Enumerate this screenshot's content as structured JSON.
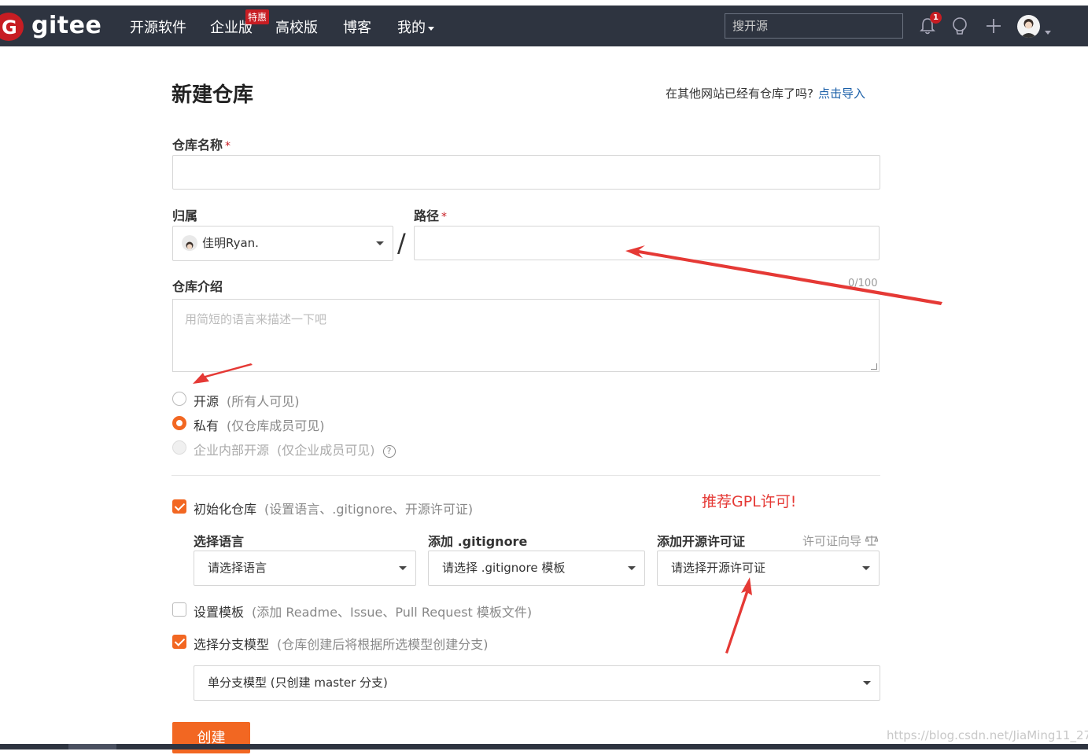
{
  "nav": {
    "logo": "gitee",
    "items": [
      "开源软件",
      "企业版",
      "高校版",
      "博客",
      "我的"
    ],
    "hot_badge": "特惠",
    "search_placeholder": "搜开源",
    "notification_count": "1"
  },
  "form": {
    "title": "新建仓库",
    "import_text": "在其他网站已经有仓库了吗?",
    "import_link": "点击导入",
    "repo_name_label": "仓库名称",
    "required_mark": "*",
    "owner_label": "归属",
    "owner_value": "佳明Ryan.",
    "path_label": "路径",
    "desc_label": "仓库介绍",
    "desc_counter": "0/100",
    "desc_placeholder": "用简短的语言来描述一下吧",
    "visibility": [
      {
        "label": "开源",
        "hint": "(所有人可见)",
        "selected": false,
        "disabled": false
      },
      {
        "label": "私有",
        "hint": "(仅仓库成员可见)",
        "selected": true,
        "disabled": false
      },
      {
        "label": "企业内部开源",
        "hint": "(仅企业成员可见)",
        "selected": false,
        "disabled": true
      }
    ],
    "init_label": "初始化仓库",
    "init_hint": "(设置语言、.gitignore、开源许可证)",
    "init_checked": true,
    "lang_label": "选择语言",
    "lang_value": "请选择语言",
    "gitignore_label": "添加 .gitignore",
    "gitignore_value": "请选择 .gitignore 模板",
    "license_label": "添加开源许可证",
    "license_wizard": "许可证向导",
    "license_value": "请选择开源许可证",
    "template_label": "设置模板",
    "template_hint": "(添加 Readme、Issue、Pull Request 模板文件)",
    "template_checked": false,
    "branch_label": "选择分支模型",
    "branch_hint": "(仓库创建后将根据所选模型创建分支)",
    "branch_checked": true,
    "branch_value": "单分支模型 (只创建 master 分支)",
    "create_button": "创建"
  },
  "annotation": {
    "note": "推荐GPL许可!",
    "color": "#e53935"
  },
  "watermark": "https://blog.csdn.net/JiaMing11_27",
  "colors": {
    "navbar": "#2e3440",
    "accent": "#f26722",
    "brand": "#c71d23",
    "link": "#1a5fa8"
  }
}
